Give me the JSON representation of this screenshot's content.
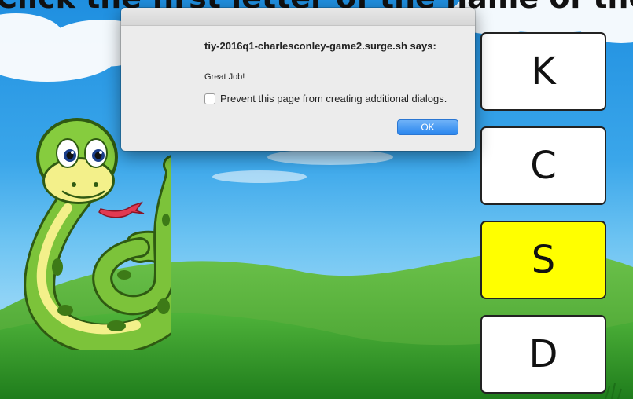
{
  "page": {
    "prompt": "Click the first letter of the name of the animal"
  },
  "answers": [
    {
      "letter": "K",
      "selected": false
    },
    {
      "letter": "C",
      "selected": false
    },
    {
      "letter": "S",
      "selected": true
    },
    {
      "letter": "D",
      "selected": false
    }
  ],
  "dialog": {
    "origin": "tiy-2016q1-charlesconley-game2.surge.sh says:",
    "message": "Great Job!",
    "prevent_label": "Prevent this page from creating additional dialogs.",
    "prevent_checked": false,
    "ok_label": "OK"
  },
  "colors": {
    "selected_answer": "#ffff00",
    "ok_button": "#2a86ee",
    "sky": "#3aa6ea",
    "grass": "#2f9a2a"
  },
  "icons": {
    "animal": "snake-illustration"
  }
}
